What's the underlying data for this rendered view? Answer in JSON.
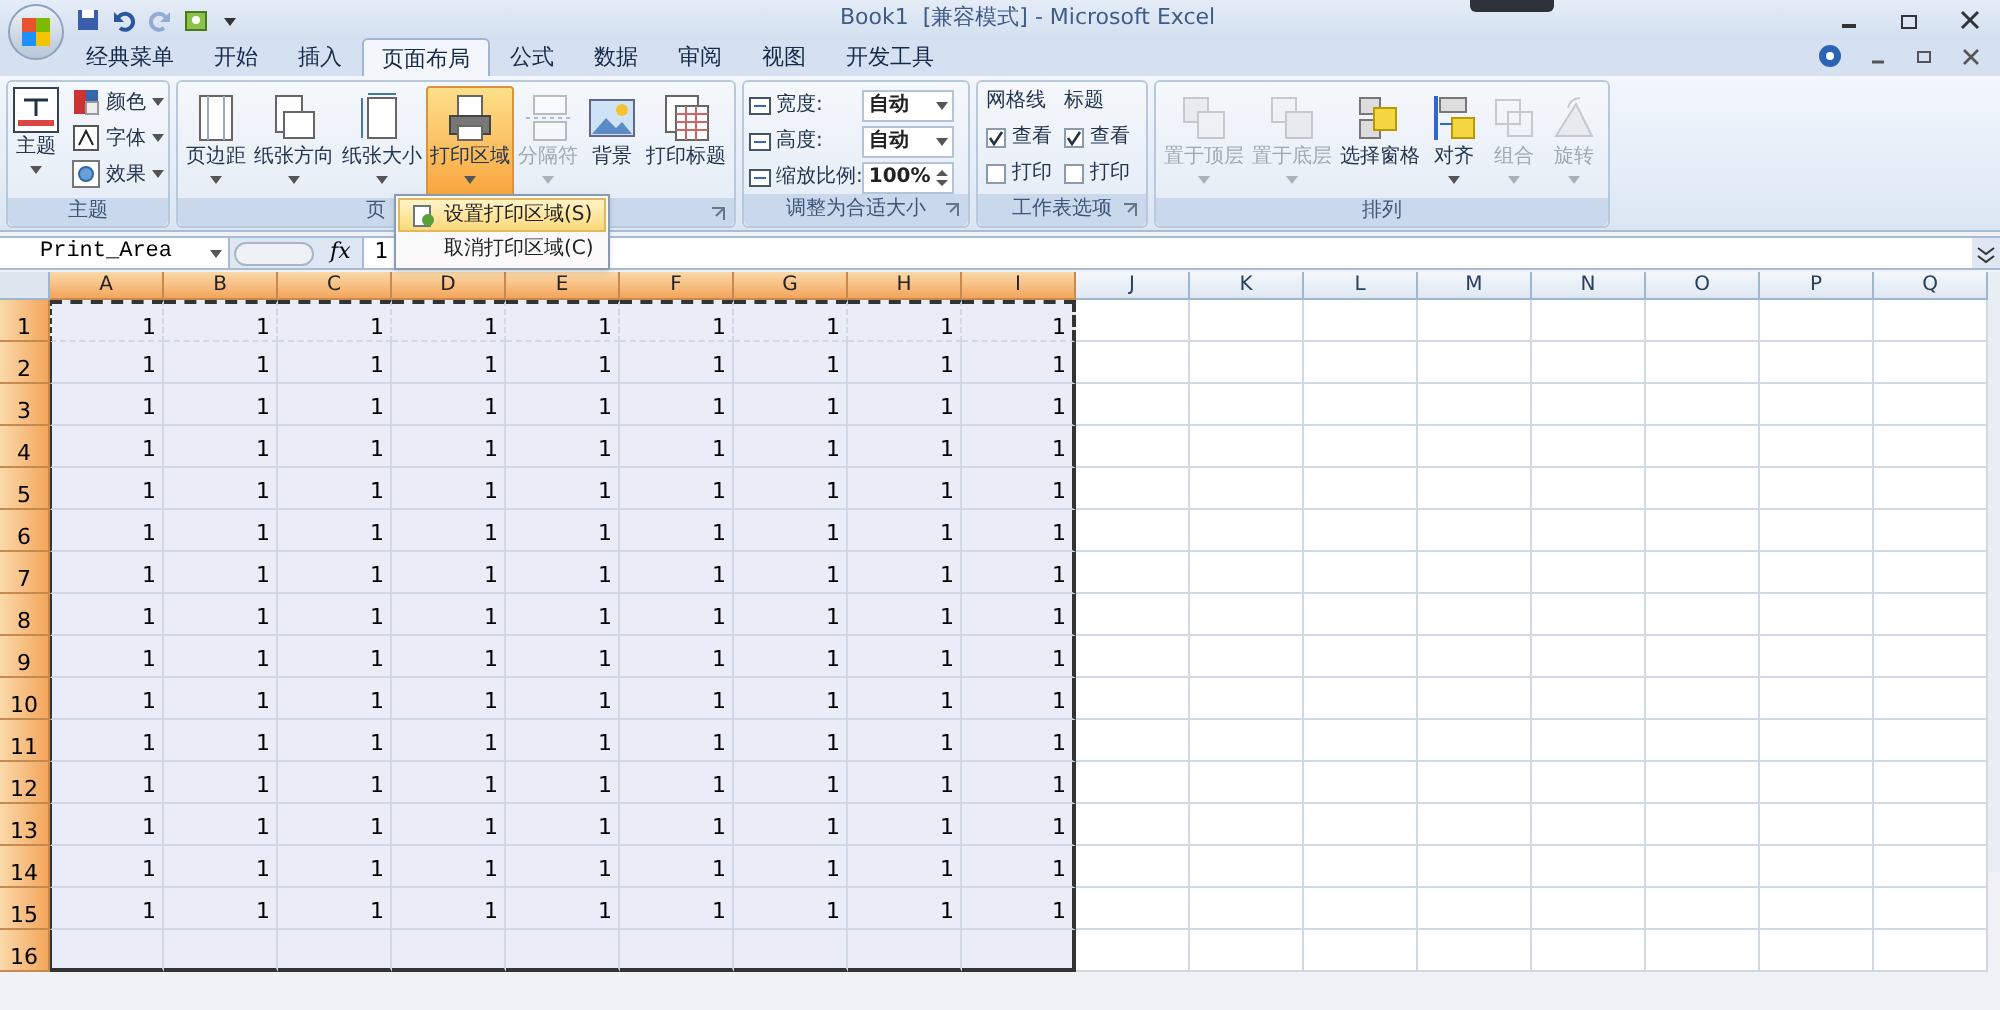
{
  "window": {
    "title": "Book1  [兼容模式] - Microsoft Excel"
  },
  "tabs": [
    {
      "label": "经典菜单",
      "selected": false
    },
    {
      "label": "开始",
      "selected": false
    },
    {
      "label": "插入",
      "selected": false
    },
    {
      "label": "页面布局",
      "selected": true
    },
    {
      "label": "公式",
      "selected": false
    },
    {
      "label": "数据",
      "selected": false
    },
    {
      "label": "审阅",
      "selected": false
    },
    {
      "label": "视图",
      "selected": false
    },
    {
      "label": "开发工具",
      "selected": false
    }
  ],
  "ribbon": {
    "theme_group": {
      "label": "主题",
      "main": "主题",
      "items": [
        {
          "label": "颜色"
        },
        {
          "label": "字体"
        },
        {
          "label": "效果"
        }
      ]
    },
    "page_setup_group": {
      "label": "页",
      "buttons": [
        {
          "label": "页边距",
          "active": false,
          "disabled": false
        },
        {
          "label": "纸张方向",
          "active": false,
          "disabled": false
        },
        {
          "label": "纸张大小",
          "active": false,
          "disabled": false
        },
        {
          "label": "打印区域",
          "active": true,
          "disabled": false
        },
        {
          "label": "分隔符",
          "active": false,
          "disabled": true
        },
        {
          "label": "背景",
          "active": false,
          "disabled": false
        },
        {
          "label": "打印标题",
          "active": false,
          "disabled": false
        }
      ]
    },
    "scale_group": {
      "label": "调整为合适大小",
      "fields": [
        {
          "label": "宽度:",
          "value": "自动",
          "kind": "select"
        },
        {
          "label": "高度:",
          "value": "自动",
          "kind": "select"
        },
        {
          "label": "缩放比例:",
          "value": "100%",
          "kind": "spin"
        }
      ]
    },
    "sheet_options_group": {
      "label": "工作表选项",
      "columns": [
        {
          "title": "网格线",
          "options": [
            {
              "label": "查看",
              "checked": true
            },
            {
              "label": "打印",
              "checked": false
            }
          ]
        },
        {
          "title": "标题",
          "options": [
            {
              "label": "查看",
              "checked": true
            },
            {
              "label": "打印",
              "checked": false
            }
          ]
        }
      ]
    },
    "arrange_group": {
      "label": "排列",
      "buttons": [
        {
          "label": "置于顶层",
          "disabled": true
        },
        {
          "label": "置于底层",
          "disabled": true
        },
        {
          "label": "选择窗格",
          "disabled": false
        },
        {
          "label": "对齐",
          "disabled": false
        },
        {
          "label": "组合",
          "disabled": true
        },
        {
          "label": "旋转",
          "disabled": true
        }
      ]
    }
  },
  "dropdown_menu": {
    "items": [
      {
        "label": "设置打印区域(S)",
        "selected": true
      },
      {
        "label": "取消打印区域(C)",
        "selected": false
      }
    ]
  },
  "formula_bar": {
    "name_box": "Print_Area",
    "fx": "fx",
    "value": "1"
  },
  "sheet": {
    "columns": [
      {
        "label": "A",
        "selected": true
      },
      {
        "label": "B",
        "selected": true
      },
      {
        "label": "C",
        "selected": true
      },
      {
        "label": "D",
        "selected": true
      },
      {
        "label": "E",
        "selected": true
      },
      {
        "label": "F",
        "selected": true
      },
      {
        "label": "G",
        "selected": true
      },
      {
        "label": "H",
        "selected": true
      },
      {
        "label": "I",
        "selected": true
      },
      {
        "label": "J",
        "selected": false
      },
      {
        "label": "K",
        "selected": false
      },
      {
        "label": "L",
        "selected": false
      },
      {
        "label": "M",
        "selected": false
      },
      {
        "label": "N",
        "selected": false
      },
      {
        "label": "O",
        "selected": false
      },
      {
        "label": "P",
        "selected": false
      },
      {
        "label": "Q",
        "selected": false
      }
    ],
    "rows": [
      {
        "label": "1",
        "selected": true,
        "cells": [
          "1",
          "1",
          "1",
          "1",
          "1",
          "1",
          "1",
          "1",
          "1"
        ]
      },
      {
        "label": "2",
        "selected": true,
        "cells": [
          "1",
          "1",
          "1",
          "1",
          "1",
          "1",
          "1",
          "1",
          "1"
        ]
      },
      {
        "label": "3",
        "selected": true,
        "cells": [
          "1",
          "1",
          "1",
          "1",
          "1",
          "1",
          "1",
          "1",
          "1"
        ]
      },
      {
        "label": "4",
        "selected": true,
        "cells": [
          "1",
          "1",
          "1",
          "1",
          "1",
          "1",
          "1",
          "1",
          "1"
        ]
      },
      {
        "label": "5",
        "selected": true,
        "cells": [
          "1",
          "1",
          "1",
          "1",
          "1",
          "1",
          "1",
          "1",
          "1"
        ]
      },
      {
        "label": "6",
        "selected": true,
        "cells": [
          "1",
          "1",
          "1",
          "1",
          "1",
          "1",
          "1",
          "1",
          "1"
        ]
      },
      {
        "label": "7",
        "selected": true,
        "cells": [
          "1",
          "1",
          "1",
          "1",
          "1",
          "1",
          "1",
          "1",
          "1"
        ]
      },
      {
        "label": "8",
        "selected": true,
        "cells": [
          "1",
          "1",
          "1",
          "1",
          "1",
          "1",
          "1",
          "1",
          "1"
        ]
      },
      {
        "label": "9",
        "selected": true,
        "cells": [
          "1",
          "1",
          "1",
          "1",
          "1",
          "1",
          "1",
          "1",
          "1"
        ]
      },
      {
        "label": "10",
        "selected": true,
        "cells": [
          "1",
          "1",
          "1",
          "1",
          "1",
          "1",
          "1",
          "1",
          "1"
        ]
      },
      {
        "label": "11",
        "selected": true,
        "cells": [
          "1",
          "1",
          "1",
          "1",
          "1",
          "1",
          "1",
          "1",
          "1"
        ]
      },
      {
        "label": "12",
        "selected": true,
        "cells": [
          "1",
          "1",
          "1",
          "1",
          "1",
          "1",
          "1",
          "1",
          "1"
        ]
      },
      {
        "label": "13",
        "selected": true,
        "cells": [
          "1",
          "1",
          "1",
          "1",
          "1",
          "1",
          "1",
          "1",
          "1"
        ]
      },
      {
        "label": "14",
        "selected": true,
        "cells": [
          "1",
          "1",
          "1",
          "1",
          "1",
          "1",
          "1",
          "1",
          "1"
        ]
      },
      {
        "label": "15",
        "selected": true,
        "cells": [
          "1",
          "1",
          "1",
          "1",
          "1",
          "1",
          "1",
          "1",
          "1"
        ]
      },
      {
        "label": "16",
        "selected": true,
        "cells": []
      }
    ]
  }
}
